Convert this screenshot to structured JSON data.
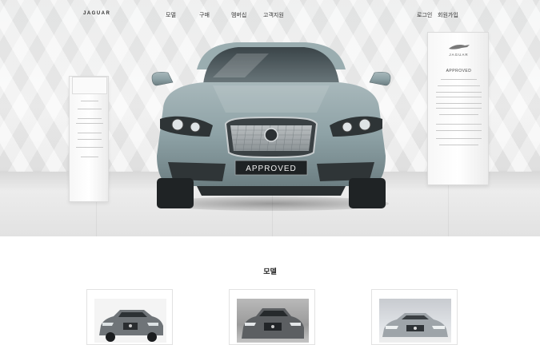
{
  "nav": {
    "logo": "JAGUAR",
    "items": [
      "모델",
      "구매",
      "멤버십",
      "고객지원"
    ],
    "login": "로그인",
    "signup": "회원가입"
  },
  "hero": {
    "plate_text": "APPROVED",
    "stand_right_brand": "JAGUAR",
    "stand_right_title": "APPROVED"
  },
  "models_section": {
    "title": "모델"
  },
  "colors": {
    "car_body": "#8fa3a6",
    "background": "#ffffff"
  }
}
